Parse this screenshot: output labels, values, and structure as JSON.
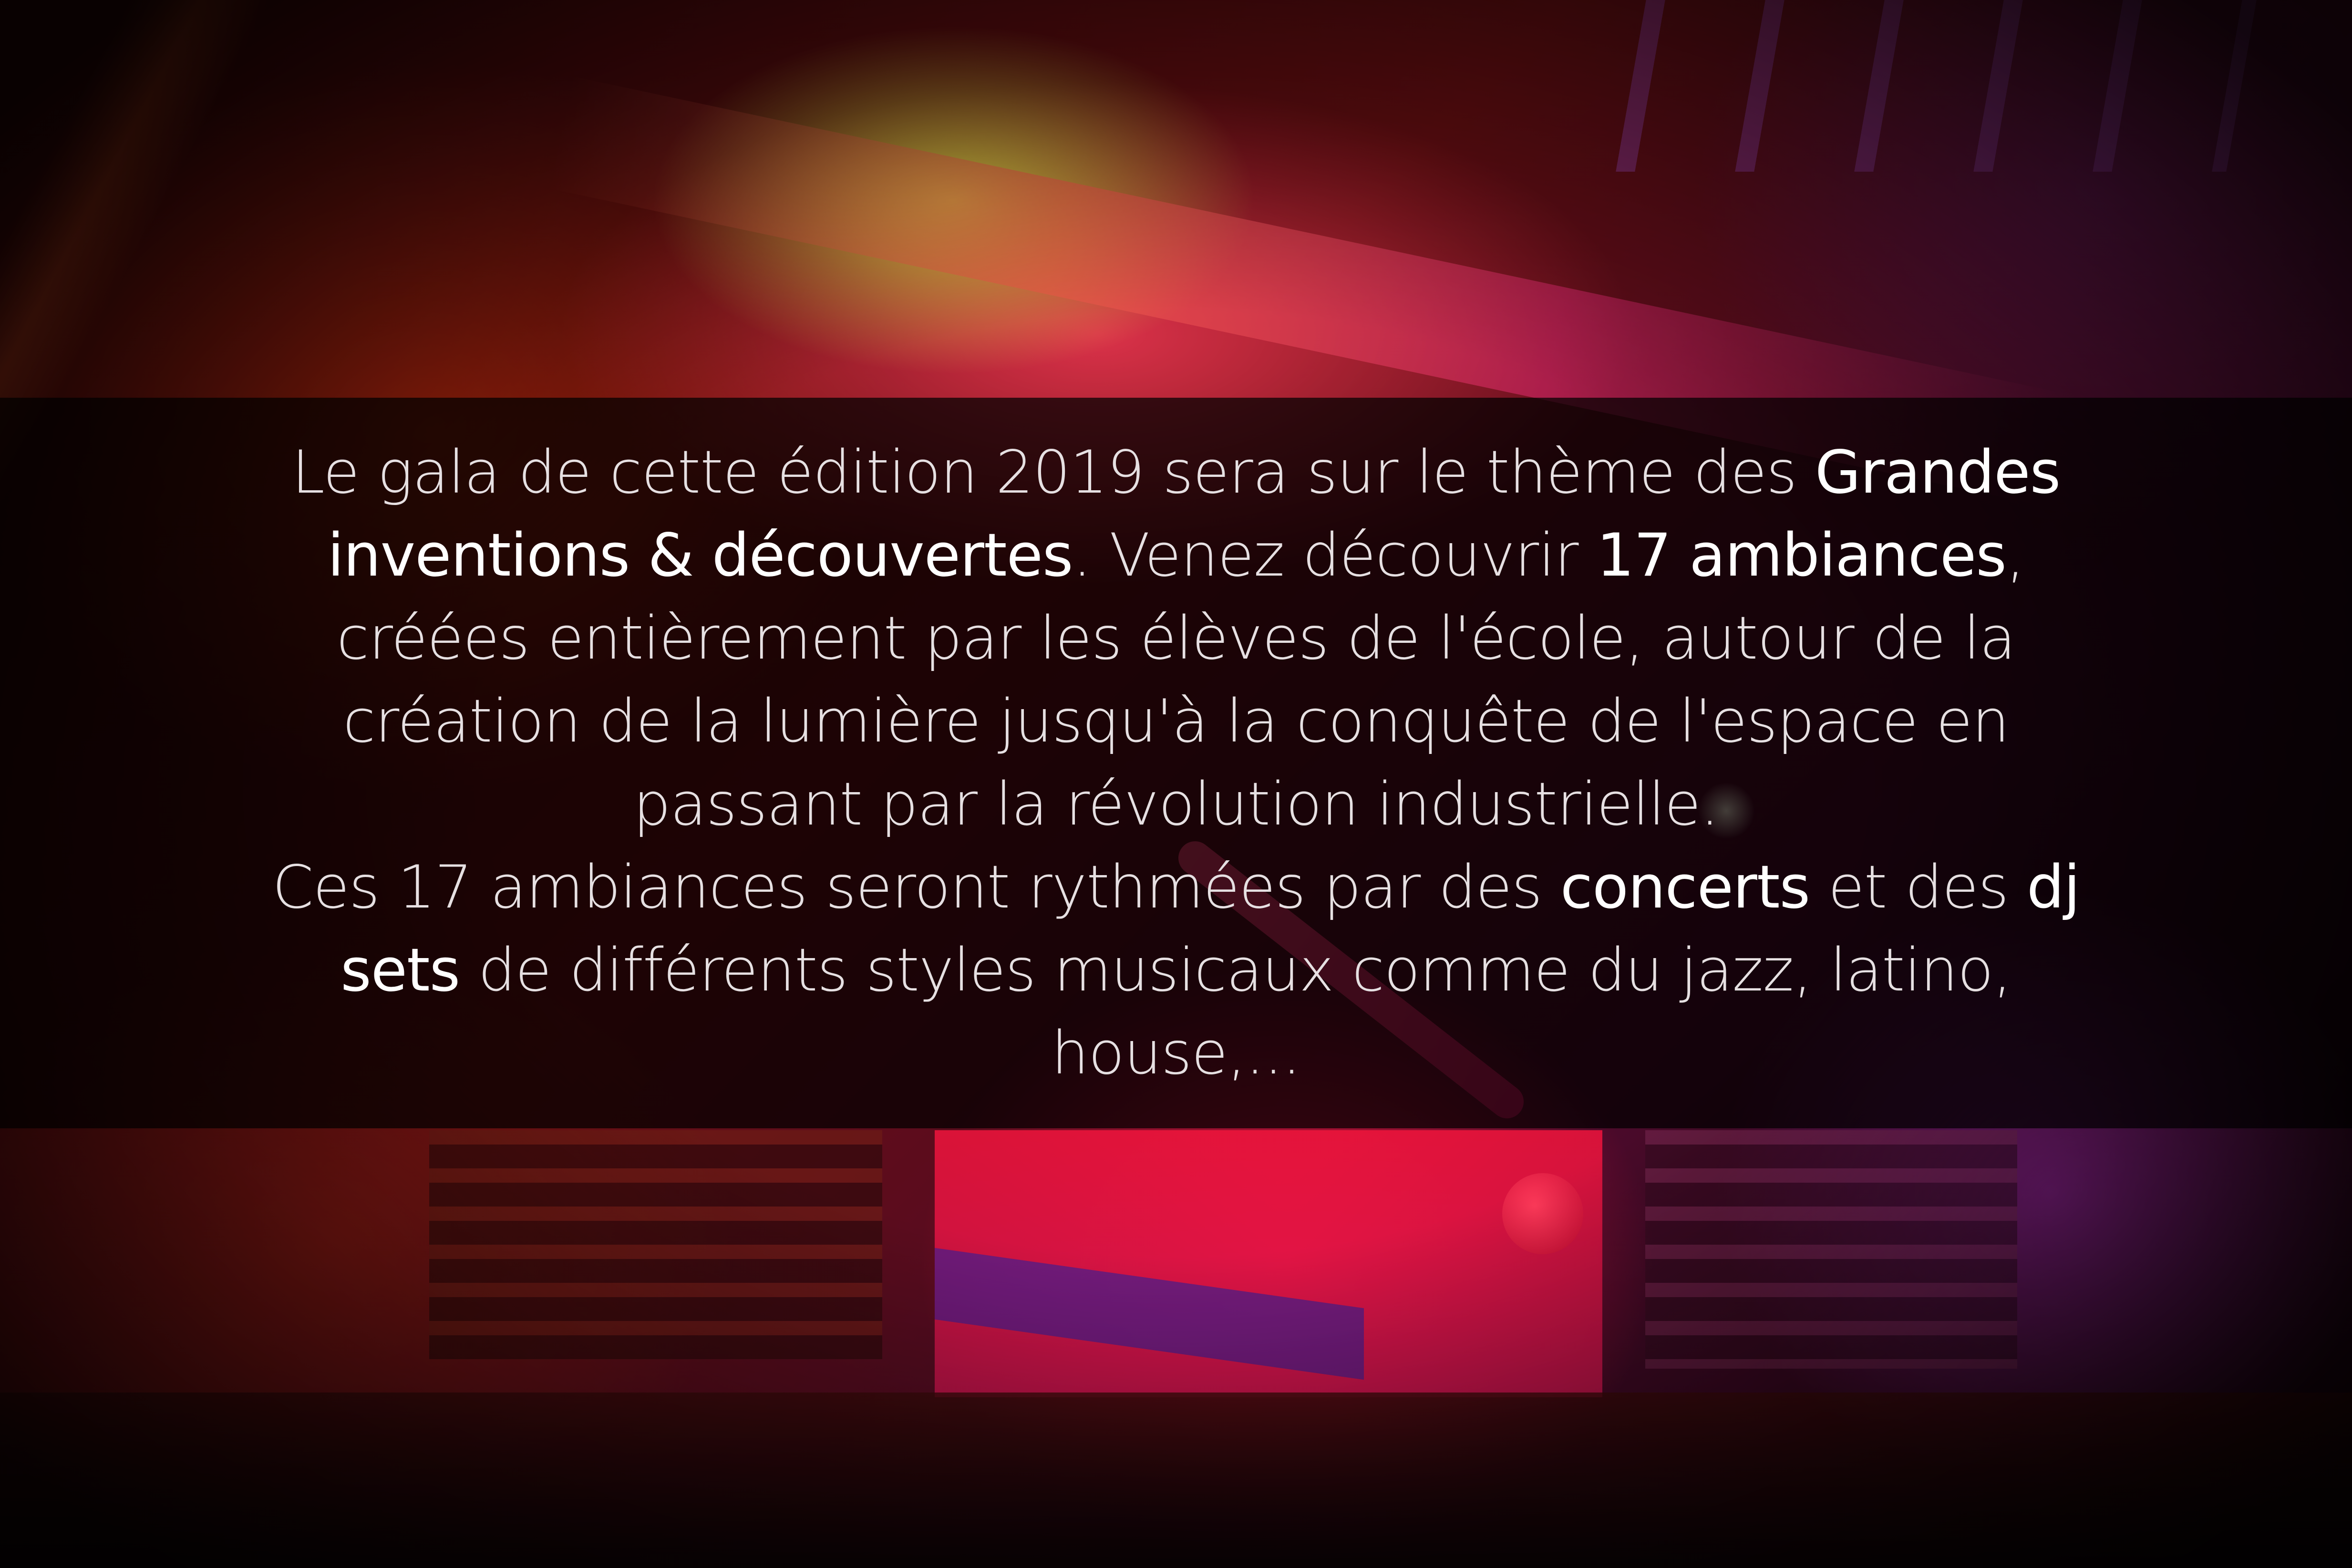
{
  "poster": {
    "paragraph1": {
      "part1": "Le gala de cette édition 2019 sera sur le thème des ",
      "highlight1": "Grandes inventions & découvertes",
      "part2": ". Venez découvrir ",
      "highlight2": "17 ambiances",
      "part3": ", créées entièrement par les élèves de l'école, autour de la création de la lumière jusqu'à la conquête de l'espace en passant par la révolution industrielle."
    },
    "paragraph2": {
      "part1": "Ces 17 ambiances seront rythmées par des ",
      "highlight1": "concerts",
      "part2": " et des ",
      "highlight2": "dj sets",
      "part3": " de différents styles musicaux comme du jazz, latino, house,..."
    }
  },
  "colors": {
    "band": "#000000",
    "text": "#e6e0e2",
    "highlight": "#ffffff",
    "accent_yellow": "#d6d642",
    "accent_red": "#ec143e",
    "accent_purple": "#96269f"
  }
}
